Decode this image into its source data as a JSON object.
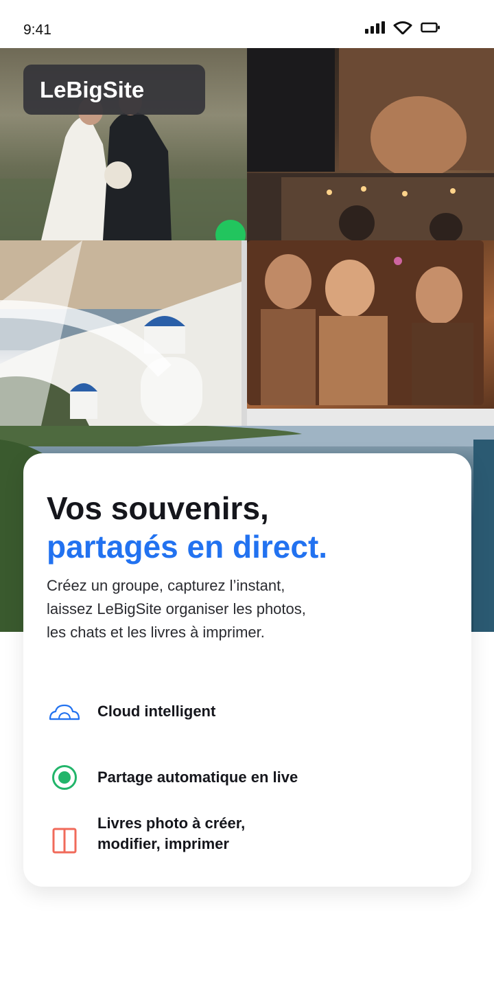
{
  "status_bar": {
    "time": "9:41"
  },
  "brand": {
    "name": "LeBigSite"
  },
  "hero": {
    "headline": "Vos souvenirs,",
    "headline_accent": "partagés en direct.",
    "description": "Créez un groupe, capturez l’instant, laissez LeBigSite organiser les photos, les chats et les livres à imprimer."
  },
  "features": [
    {
      "label": "Cloud intelligent",
      "icon": "cloud-icon",
      "color": "#2272f0"
    },
    {
      "label": "Partage automatique en live",
      "icon": "live-dot-icon",
      "color": "#22b56a"
    },
    {
      "label_line1": "Livres photo à créer,",
      "label_line2": "modifier, imprimer",
      "icon": "book-icon",
      "color": "#f06a5a"
    }
  ],
  "colors": {
    "accent": "#2272f0",
    "text": "#15161c",
    "badge_bg": "#34343a"
  }
}
